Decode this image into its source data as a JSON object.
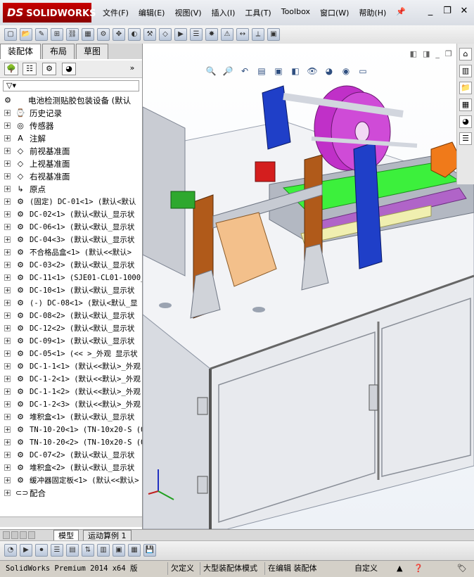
{
  "app": {
    "logo_brand": "SOLIDWORKS",
    "logo_mark": "DS"
  },
  "menu": [
    "文件(F)",
    "编辑(E)",
    "视图(V)",
    "插入(I)",
    "工具(T)",
    "Toolbox",
    "窗口(W)",
    "帮助(H)"
  ],
  "left_tabs": [
    "装配体",
    "布局",
    "草图"
  ],
  "tree": {
    "root": "电池检测贴胶包装设备 (默认",
    "items": [
      {
        "icon": "history-icon",
        "text": "历史记录",
        "top": true
      },
      {
        "icon": "sensor-icon",
        "text": "传感器",
        "top": true
      },
      {
        "icon": "annotation-icon",
        "text": "注解",
        "top": true
      },
      {
        "icon": "plane-icon",
        "text": "前视基准面",
        "top": true
      },
      {
        "icon": "plane-icon",
        "text": "上视基准面",
        "top": true
      },
      {
        "icon": "plane-icon",
        "text": "右视基准面",
        "top": true
      },
      {
        "icon": "origin-icon",
        "text": "原点",
        "top": true
      },
      {
        "icon": "part-icon",
        "text": "(固定) DC-01<1> (默认<默认"
      },
      {
        "icon": "part-icon",
        "text": "DC-02<1> (默认<默认_显示状"
      },
      {
        "icon": "part-icon",
        "text": "DC-06<1> (默认<默认_显示状"
      },
      {
        "icon": "part-icon",
        "text": "DC-04<3> (默认<默认_显示状"
      },
      {
        "icon": "part-icon",
        "text": "不合格品盒<1> (默认<<默认>"
      },
      {
        "icon": "part-icon",
        "text": "DC-03<2> (默认<默认_显示状"
      },
      {
        "icon": "part-icon",
        "text": "DC-11<1> (SJE01-CL01-1000_"
      },
      {
        "icon": "part-icon",
        "text": "DC-10<1> (默认<默认_显示状"
      },
      {
        "icon": "part-icon",
        "text": "(-) DC-08<1> (默认<默认_显"
      },
      {
        "icon": "part-icon",
        "text": "DC-08<2> (默认<默认_显示状"
      },
      {
        "icon": "part-icon",
        "text": "DC-12<2> (默认<默认_显示状"
      },
      {
        "icon": "part-icon",
        "text": "DC-09<1> (默认<默认_显示状"
      },
      {
        "icon": "part-icon",
        "text": "DC-05<1> (<< >_外观 显示状"
      },
      {
        "icon": "part-icon",
        "text": "DC-1-1<1> (默认<<默认>_外观"
      },
      {
        "icon": "part-icon",
        "text": "DC-1-2<1> (默认<<默认>_外观"
      },
      {
        "icon": "part-icon",
        "text": "DC-1-1<2> (默认<<默认>_外观"
      },
      {
        "icon": "part-icon",
        "text": "DC-1-2<3> (默认<<默认>_外观"
      },
      {
        "icon": "part-icon",
        "text": "堆积盒<1> (默认<默认_显示状"
      },
      {
        "icon": "part-icon",
        "text": "TN-10-20<1> (TN-10x20-S (0"
      },
      {
        "icon": "part-icon",
        "text": "TN-10-20<2> (TN-10x20-S (0"
      },
      {
        "icon": "part-icon",
        "text": "DC-07<2> (默认<默认_显示状"
      },
      {
        "icon": "part-icon",
        "text": "堆积盒<2> (默认<默认_显示状"
      },
      {
        "icon": "part-icon",
        "text": "缓冲器固定板<1> (默认<<默认>"
      },
      {
        "icon": "mate-icon",
        "text": "配合",
        "top": true
      }
    ]
  },
  "bottom_tabs": [
    "模型",
    "运动算例 1"
  ],
  "status": {
    "version": "SolidWorks Premium 2014 x64 版",
    "underdefined": "欠定义",
    "large_assembly": "大型装配体模式",
    "editing": "在编辑 装配体",
    "custom": "自定义"
  },
  "colors": {
    "accent": "#8a0000",
    "frame_blue": "#1f3fc8",
    "frame_brown": "#b05a1a",
    "belt_green": "#3cf03c",
    "roll_magenta": "#c030c8"
  }
}
